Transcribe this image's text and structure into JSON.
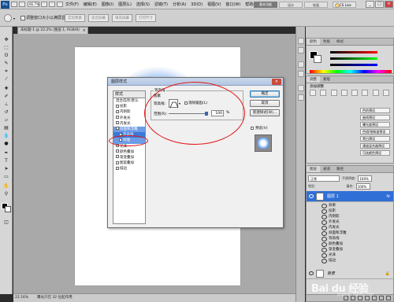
{
  "app": {
    "logo": "Ps",
    "menu": [
      "文件(F)",
      "编辑(E)",
      "图像(I)",
      "图层(L)",
      "选择(S)",
      "滤镜(T)",
      "分析(A)",
      "3D(D)",
      "视图(V)",
      "窗口(W)",
      "帮助(H)"
    ],
    "zoom_level": "66.7%",
    "workspace_buttons": [
      "基本功能",
      "设计",
      "绘画"
    ],
    "cs_live": "CS Live",
    "window_buttons": [
      "_",
      "□",
      "×"
    ]
  },
  "options": {
    "resize_windows_label": "调整窗口大小以满屏显示",
    "buttons": [
      "实际像素",
      "适合屏幕",
      "填充屏幕",
      "打印尺寸"
    ]
  },
  "document": {
    "tab_label": "未标题-1 @ 22.2% (图层 1, RGB/8)",
    "zoom": "22.16%",
    "status": "曝光只在 32 位起作用"
  },
  "panels": {
    "color_tabs": [
      "颜色",
      "色板",
      "样式"
    ],
    "adjust_tabs": [
      "调整",
      "蒙版"
    ],
    "adjust_title": "添加调整",
    "presets": [
      "色阶预设",
      "曲线预设",
      "曝光度预设",
      "色相/饱和度预设",
      "黑白预设",
      "通道混合器预设",
      "可选颜色预设"
    ],
    "layers_tabs": [
      "图层",
      "通道",
      "路径"
    ],
    "blend_mode": "正常",
    "opacity_label": "不透明度:",
    "opacity_value": "100%",
    "lock_label": "锁定:",
    "fill_label": "填充:",
    "fill_value": "100%",
    "layer1": "图层 1",
    "effects_label": "效果",
    "effects": [
      "投影",
      "内阴影",
      "外发光",
      "内发光",
      "斜面和浮雕",
      "等高线",
      "颜色叠加",
      "渐变叠加",
      "光泽",
      "描边"
    ],
    "background_layer": "背景"
  },
  "dialog": {
    "title": "图层样式",
    "styles_header": "样式",
    "style_items": [
      {
        "label": "混合选项:默认",
        "checked": false
      },
      {
        "label": "投影",
        "checked": true
      },
      {
        "label": "内阴影",
        "checked": true
      },
      {
        "label": "外发光",
        "checked": true
      },
      {
        "label": "内发光",
        "checked": true
      },
      {
        "label": "斜面和浮雕",
        "checked": true
      },
      {
        "label": "等高线",
        "checked": true
      },
      {
        "label": "纹理",
        "checked": false
      },
      {
        "label": "光泽",
        "checked": true
      },
      {
        "label": "颜色叠加",
        "checked": true
      },
      {
        "label": "渐变叠加",
        "checked": true
      },
      {
        "label": "图案叠加",
        "checked": false
      },
      {
        "label": "描边",
        "checked": true
      }
    ],
    "section_title": "等高线",
    "section_sub": "图素",
    "contour_label": "等高线:",
    "anti_alias_label": "消除锯齿(L)",
    "range_label": "范围(R):",
    "range_value": "100",
    "range_unit": "%",
    "range_fraction": 1.0,
    "buttons": {
      "ok": "确定",
      "cancel": "取消",
      "new_style": "新建样式(W)...",
      "preview": "预览(V)"
    }
  },
  "watermark": {
    "brand": "Bai du 经验",
    "sub": "jingyan.baidu.com"
  },
  "colors": {
    "annotation": "#e31414",
    "selection": "#3a79d8",
    "layer_selected": "#2f6fd6"
  }
}
